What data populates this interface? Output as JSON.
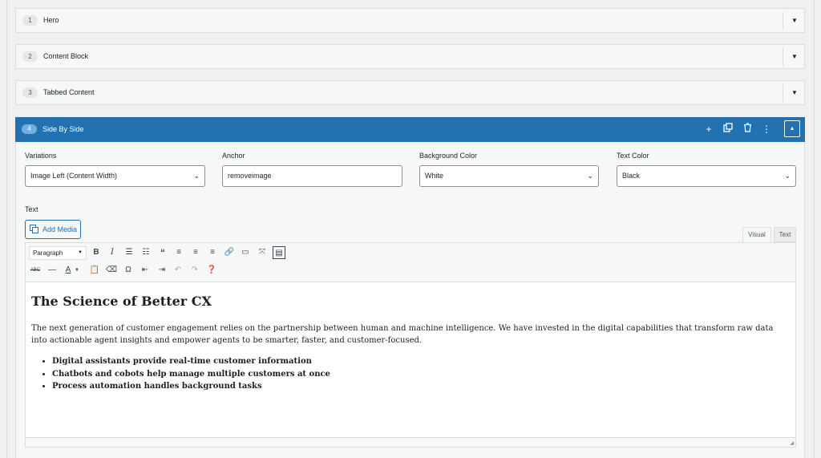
{
  "layouts": [
    {
      "num": "1",
      "title": "Hero"
    },
    {
      "num": "2",
      "title": "Content Block"
    },
    {
      "num": "3",
      "title": "Tabbed Content"
    }
  ],
  "active": {
    "num": "4",
    "title": "Side By Side",
    "fields": {
      "variations": {
        "label": "Variations",
        "value": "Image Left (Content Width)"
      },
      "anchor": {
        "label": "Anchor",
        "value": "removeimage"
      },
      "bg_color": {
        "label": "Background Color",
        "value": "White"
      },
      "text_color": {
        "label": "Text Color",
        "value": "Black"
      }
    },
    "text_label": "Text",
    "add_media": "Add Media",
    "tabs": {
      "visual": "Visual",
      "text": "Text"
    },
    "format": "Paragraph",
    "content": {
      "heading": "The Science of Better CX",
      "paragraph": "The next generation of customer engagement relies on the partnership between human and machine intelligence. We have invested in the digital capabilities that transform raw data into actionable agent insights and empower agents to be smarter, faster, and customer-focused.",
      "bullets": [
        "Digital assistants provide real-time customer information",
        "Chatbots and cobots help manage multiple customers at once",
        "Process automation handles background tasks"
      ]
    }
  },
  "colors": {
    "accent": "#2271b1",
    "border": "#dcdcde",
    "panel": "#f6f7f7"
  },
  "icons": [
    "add-icon",
    "duplicate-icon",
    "trash-icon",
    "more-icon",
    "collapse-icon",
    "bold-icon",
    "italic-icon",
    "bullet-list-icon",
    "numbered-list-icon",
    "blockquote-icon",
    "align-left-icon",
    "align-center-icon",
    "align-right-icon",
    "link-icon",
    "read-more-icon",
    "fullscreen-icon",
    "toolbar-toggle-icon",
    "strikethrough-icon",
    "horizontal-line-icon",
    "text-color-icon",
    "paste-text-icon",
    "clear-formatting-icon",
    "special-character-icon",
    "outdent-icon",
    "indent-icon",
    "undo-icon",
    "redo-icon",
    "help-icon"
  ]
}
